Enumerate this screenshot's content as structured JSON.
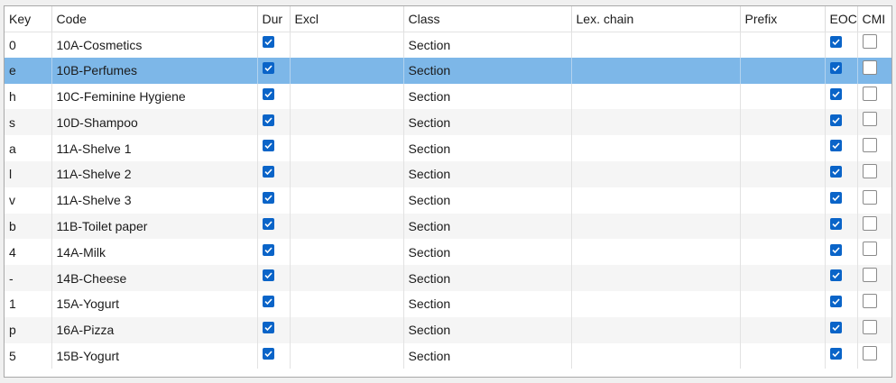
{
  "columns": [
    {
      "key": "key",
      "label": "Key"
    },
    {
      "key": "code",
      "label": "Code"
    },
    {
      "key": "dur",
      "label": "Dur"
    },
    {
      "key": "excl",
      "label": "Excl"
    },
    {
      "key": "class",
      "label": "Class"
    },
    {
      "key": "lex",
      "label": "Lex. chain"
    },
    {
      "key": "prefix",
      "label": "Prefix"
    },
    {
      "key": "eoc",
      "label": "EOC"
    },
    {
      "key": "cmi",
      "label": "CMI"
    }
  ],
  "rows": [
    {
      "key": "0",
      "code": "10A-Cosmetics",
      "dur": true,
      "excl": "",
      "class": "Section",
      "lex": "",
      "prefix": "",
      "eoc": true,
      "cmi": false,
      "selected": false
    },
    {
      "key": "e",
      "code": "10B-Perfumes",
      "dur": true,
      "excl": "",
      "class": "Section",
      "lex": "",
      "prefix": "",
      "eoc": true,
      "cmi": false,
      "selected": true
    },
    {
      "key": "h",
      "code": "10C-Feminine Hygiene",
      "dur": true,
      "excl": "",
      "class": "Section",
      "lex": "",
      "prefix": "",
      "eoc": true,
      "cmi": false,
      "selected": false
    },
    {
      "key": "s",
      "code": "10D-Shampoo",
      "dur": true,
      "excl": "",
      "class": "Section",
      "lex": "",
      "prefix": "",
      "eoc": true,
      "cmi": false,
      "selected": false
    },
    {
      "key": "a",
      "code": "11A-Shelve 1",
      "dur": true,
      "excl": "",
      "class": "Section",
      "lex": "",
      "prefix": "",
      "eoc": true,
      "cmi": false,
      "selected": false
    },
    {
      "key": "l",
      "code": "11A-Shelve 2",
      "dur": true,
      "excl": "",
      "class": "Section",
      "lex": "",
      "prefix": "",
      "eoc": true,
      "cmi": false,
      "selected": false
    },
    {
      "key": "v",
      "code": "11A-Shelve 3",
      "dur": true,
      "excl": "",
      "class": "Section",
      "lex": "",
      "prefix": "",
      "eoc": true,
      "cmi": false,
      "selected": false
    },
    {
      "key": "b",
      "code": "11B-Toilet paper",
      "dur": true,
      "excl": "",
      "class": "Section",
      "lex": "",
      "prefix": "",
      "eoc": true,
      "cmi": false,
      "selected": false
    },
    {
      "key": "4",
      "code": "14A-Milk",
      "dur": true,
      "excl": "",
      "class": "Section",
      "lex": "",
      "prefix": "",
      "eoc": true,
      "cmi": false,
      "selected": false
    },
    {
      "key": "-",
      "code": "14B-Cheese",
      "dur": true,
      "excl": "",
      "class": "Section",
      "lex": "",
      "prefix": "",
      "eoc": true,
      "cmi": false,
      "selected": false
    },
    {
      "key": "1",
      "code": "15A-Yogurt",
      "dur": true,
      "excl": "",
      "class": "Section",
      "lex": "",
      "prefix": "",
      "eoc": true,
      "cmi": false,
      "selected": false
    },
    {
      "key": "p",
      "code": "16A-Pizza",
      "dur": true,
      "excl": "",
      "class": "Section",
      "lex": "",
      "prefix": "",
      "eoc": true,
      "cmi": false,
      "selected": false
    },
    {
      "key": "5",
      "code": "15B-Yogurt",
      "dur": true,
      "excl": "",
      "class": "Section",
      "lex": "",
      "prefix": "",
      "eoc": true,
      "cmi": false,
      "selected": false
    }
  ],
  "colors": {
    "selected_row": "#7db7e8",
    "checkbox_checked": "#0a64c8",
    "alt_row": "#f5f5f5"
  },
  "icons": {
    "checked": "checkbox-checked-icon",
    "unchecked": "checkbox-unchecked-icon"
  }
}
